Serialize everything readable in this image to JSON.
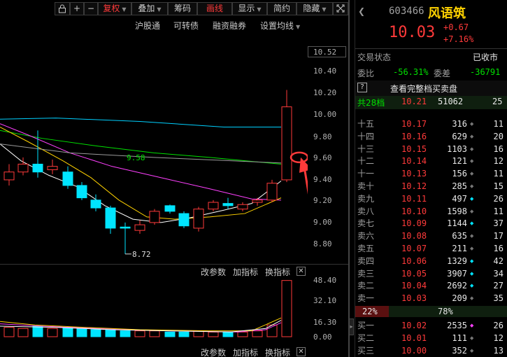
{
  "toolbar": {
    "lock_icon": "lock-icon",
    "plus": "+",
    "minus": "−",
    "fuquan": "复权",
    "diejia": "叠加",
    "choumа": "筹码",
    "huaxian": "画线",
    "xianshi": "显示",
    "jianyue": "简约",
    "yincang": "隐藏"
  },
  "subbar": {
    "hugutong": "沪股通",
    "kezhuanzhai": "可转债",
    "rongzirongquan": "融资融券",
    "shezhi": "设置均线"
  },
  "price_axis": [
    "10.52",
    "10.40",
    "10.20",
    "10.00",
    "9.80",
    "9.60",
    "9.40",
    "9.20",
    "9.00",
    "8.80"
  ],
  "ma_label": "9.58",
  "low_label": "8.72",
  "vol_toolbar": {
    "gaicanshu": "改参数",
    "jiazhibiao": "加指标",
    "huanzhibiao": "换指标"
  },
  "vol_axis": [
    "48.40",
    "32.10",
    "16.30",
    "0.00"
  ],
  "stock": {
    "code": "603466",
    "name": "风语筑",
    "price": "10.03",
    "change": "+0.67",
    "pct": "+7.16%"
  },
  "status": {
    "label": "交易状态",
    "value": "已收市"
  },
  "weibi": {
    "label": "委比",
    "value": "-56.31%",
    "label2": "委差",
    "value2": "-36791"
  },
  "view_full": {
    "q": "?",
    "label": "查看完整档买卖盘"
  },
  "total_levels": {
    "label": "共28档",
    "price": "10.21",
    "vol": "51062",
    "count": "25"
  },
  "asks": [
    {
      "label": "十五",
      "price": "10.17",
      "vol": "316",
      "count": "11",
      "dot": "grey"
    },
    {
      "label": "十四",
      "price": "10.16",
      "vol": "629",
      "count": "20",
      "dot": "grey"
    },
    {
      "label": "十三",
      "price": "10.15",
      "vol": "1103",
      "count": "16",
      "dot": "grey"
    },
    {
      "label": "十二",
      "price": "10.14",
      "vol": "121",
      "count": "12",
      "dot": "grey"
    },
    {
      "label": "十一",
      "price": "10.13",
      "vol": "156",
      "count": "11",
      "dot": "grey"
    },
    {
      "label": "卖十",
      "price": "10.12",
      "vol": "285",
      "count": "15",
      "dot": "grey"
    },
    {
      "label": "卖九",
      "price": "10.11",
      "vol": "497",
      "count": "26",
      "dot": "cyan"
    },
    {
      "label": "卖八",
      "price": "10.10",
      "vol": "1598",
      "count": "11",
      "dot": "grey"
    },
    {
      "label": "卖七",
      "price": "10.09",
      "vol": "1144",
      "count": "37",
      "dot": "cyan"
    },
    {
      "label": "卖六",
      "price": "10.08",
      "vol": "635",
      "count": "17",
      "dot": "grey"
    },
    {
      "label": "卖五",
      "price": "10.07",
      "vol": "211",
      "count": "16",
      "dot": "grey"
    },
    {
      "label": "卖四",
      "price": "10.06",
      "vol": "1329",
      "count": "42",
      "dot": "cyan"
    },
    {
      "label": "卖三",
      "price": "10.05",
      "vol": "3907",
      "count": "34",
      "dot": "cyan"
    },
    {
      "label": "卖二",
      "price": "10.04",
      "vol": "2692",
      "count": "27",
      "dot": "cyan"
    },
    {
      "label": "卖一",
      "price": "10.03",
      "vol": "209",
      "count": "35",
      "dot": "grey"
    }
  ],
  "ratio": {
    "left": "22%",
    "right": "78%",
    "left_frac": 0.22
  },
  "bids": [
    {
      "label": "买一",
      "price": "10.02",
      "vol": "2535",
      "count": "26",
      "dot": "magenta"
    },
    {
      "label": "买二",
      "price": "10.01",
      "vol": "111",
      "count": "12",
      "dot": "grey"
    },
    {
      "label": "买三",
      "price": "10.00",
      "vol": "352",
      "count": "13",
      "dot": "grey"
    }
  ],
  "colors": {
    "up": "#ff3a3a",
    "down": "#00e5ff",
    "ma5": "#ffffff",
    "ma10": "#ffd200",
    "ma20": "#ff40ff",
    "ma60": "#00e000",
    "ma120": "#00d0ff",
    "ann": "#ff3a3a"
  }
}
